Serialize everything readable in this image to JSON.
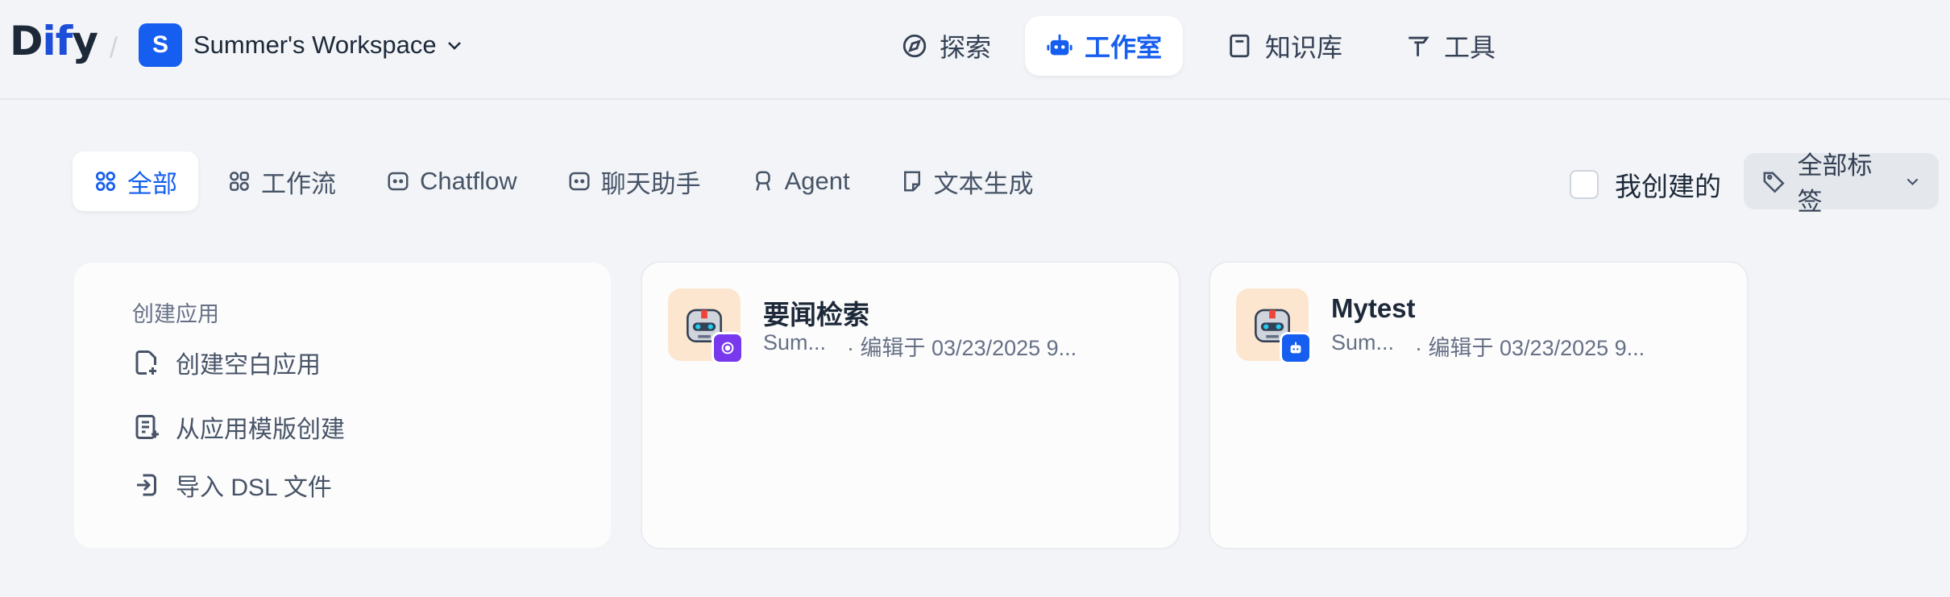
{
  "header": {
    "logo": {
      "prefix": "D",
      "highlight": "if",
      "suffix": "y"
    },
    "workspace": {
      "avatar_letter": "S",
      "name": "Summer's Workspace"
    },
    "nav": [
      {
        "label": "探索",
        "icon": "compass-icon"
      },
      {
        "label": "工作室",
        "icon": "robot-icon",
        "active": true
      },
      {
        "label": "知识库",
        "icon": "book-icon"
      },
      {
        "label": "工具",
        "icon": "hammer-icon"
      }
    ]
  },
  "filters": {
    "tabs": [
      {
        "label": "全部",
        "icon": "grid-icon",
        "active": true
      },
      {
        "label": "工作流",
        "icon": "workflow-icon"
      },
      {
        "label": "Chatflow",
        "icon": "chat-bubble-icon"
      },
      {
        "label": "聊天助手",
        "icon": "chat-bot-icon"
      },
      {
        "label": "Agent",
        "icon": "agent-icon"
      },
      {
        "label": "文本生成",
        "icon": "document-icon"
      }
    ],
    "mine_label": "我创建的",
    "tags_label": "全部标签"
  },
  "create_card": {
    "title": "创建应用",
    "items": [
      {
        "label": "创建空白应用",
        "icon": "file-plus-icon"
      },
      {
        "label": "从应用模版创建",
        "icon": "template-icon"
      },
      {
        "label": "导入 DSL 文件",
        "icon": "import-icon"
      }
    ]
  },
  "apps": [
    {
      "name": "要闻检索",
      "author": "Sum...",
      "edited": "· 编辑于 03/23/2025 9...",
      "badge_color": "#7839ee",
      "badge_icon": "agent-badge-icon"
    },
    {
      "name": "Mytest",
      "author": "Sum...",
      "edited": "· 编辑于 03/23/2025 9...",
      "badge_color": "#155eef",
      "badge_icon": "chatbot-badge-icon"
    }
  ],
  "colors": {
    "accent": "#155eef",
    "background": "#f2f4f7"
  }
}
